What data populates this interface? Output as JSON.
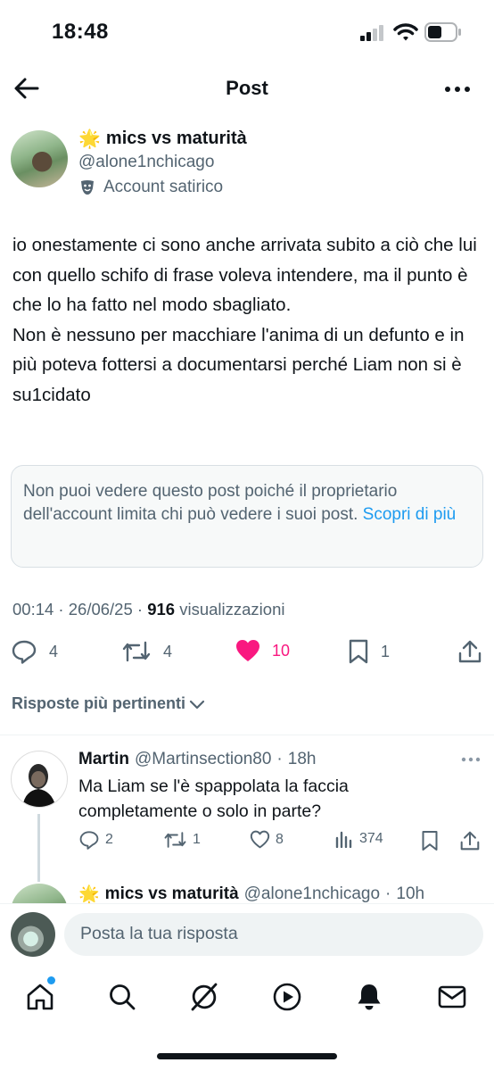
{
  "status_bar": {
    "time": "18:48"
  },
  "header": {
    "title": "Post"
  },
  "post": {
    "author_emoji": "🌟",
    "author_name": "mics vs maturità",
    "author_handle": "@alone1nchicago",
    "satire_label": "Account satirico",
    "text": "io onestamente ci sono anche arrivata subito a ciò che lui con quello schifo di frase voleva intendere, ma il punto è che lo ha fatto nel modo sbagliato.\nNon è nessuno per macchiare l'anima di un defunto e in più poteva fottersi a documentarsi perché Liam non si è su1cidato",
    "notice_text": "Non puoi vedere questo post poiché il proprietario dell'account limita chi può vedere i suoi post. ",
    "notice_link": "Scopri di più",
    "time": "00:14",
    "date": "26/06/25",
    "views_count": "916",
    "views_label": "visualizzazioni",
    "replies": "4",
    "reposts": "4",
    "likes": "10",
    "bookmarks": "1"
  },
  "sort": {
    "label": "Risposte più pertinenti"
  },
  "reply": {
    "name": "Martin",
    "handle": "@Martinsection80",
    "age": "18h",
    "text": "Ma Liam se l'è spappolata la faccia completamente o solo in parte?",
    "replies": "2",
    "reposts": "1",
    "likes": "8",
    "views": "374"
  },
  "next_reply": {
    "emoji": "🌟",
    "name": "mics vs maturità",
    "handle": "@alone1nchicago",
    "age": "10h"
  },
  "compose": {
    "placeholder": "Posta la tua risposta"
  },
  "colors": {
    "accent": "#1d9bf0",
    "like": "#f91880",
    "muted": "#536471"
  }
}
